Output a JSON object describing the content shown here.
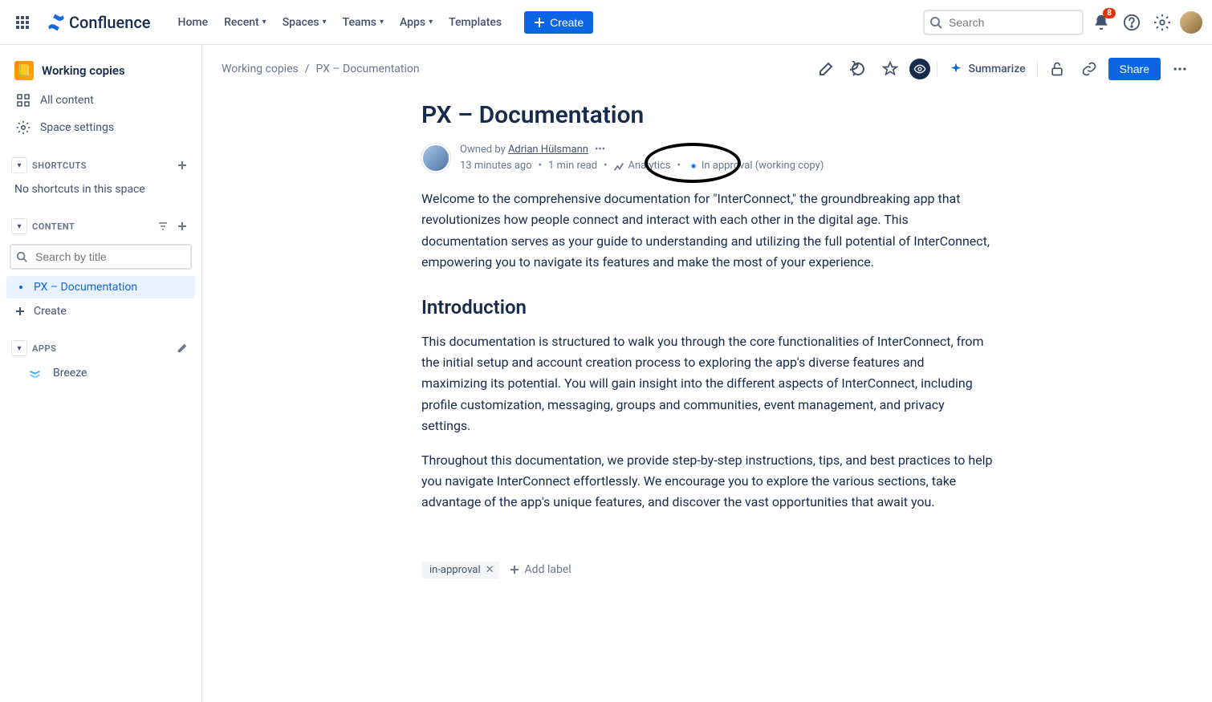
{
  "topnav": {
    "product": "Confluence",
    "items": [
      "Home",
      "Recent",
      "Spaces",
      "Teams",
      "Apps",
      "Templates"
    ],
    "dropdown": [
      false,
      true,
      true,
      true,
      true,
      false
    ],
    "create": "Create",
    "search_placeholder": "Search",
    "notification_count": "8"
  },
  "sidebar": {
    "space_name": "Working copies",
    "all_content": "All content",
    "space_settings": "Space settings",
    "shortcuts_title": "SHORTCUTS",
    "no_shortcuts": "No shortcuts in this space",
    "content_title": "CONTENT",
    "search_placeholder": "Search by title",
    "tree_item": "PX – Documentation",
    "create": "Create",
    "apps_title": "APPS",
    "app_item": "Breeze"
  },
  "breadcrumb": {
    "space": "Working copies",
    "page": "PX – Documentation"
  },
  "page_actions": {
    "summarize": "Summarize",
    "share": "Share"
  },
  "page": {
    "title": "PX – Documentation",
    "owned_by_prefix": "Owned by ",
    "author": "Adrian Hülsmann",
    "time_ago": "13 minutes ago",
    "read_time": "1 min read",
    "analytics": "Analytics",
    "status": "In approval (working copy)",
    "para1": "Welcome to the comprehensive documentation for \"InterConnect,\" the groundbreaking app that revolutionizes how people connect and interact with each other in the digital age. This documentation serves as your guide to understanding and utilizing the full potential of InterConnect, empowering you to navigate its features and make the most of your experience.",
    "h2": "Introduction",
    "para2": "This documentation is structured to walk you through the core functionalities of InterConnect, from the initial setup and account creation process to exploring the app's diverse features and maximizing its potential. You will gain insight into the different aspects of InterConnect, including profile customization, messaging, groups and communities, event management, and privacy settings.",
    "para3": "Throughout this documentation, we provide step-by-step instructions, tips, and best practices to help you navigate InterConnect effortlessly. We encourage you to explore the various sections, take advantage of the app's unique features, and discover the vast opportunities that await you."
  },
  "labels": {
    "label1": "in-approval",
    "add": "Add label"
  }
}
